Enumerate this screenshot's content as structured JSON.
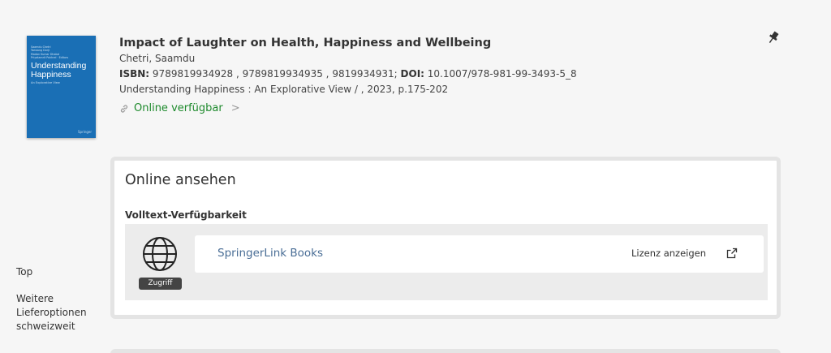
{
  "cover": {
    "authors_small": [
      "Saamdu Chetri",
      "Tsewang Dorji",
      "Madan Kumar Dhakal",
      "Priyatamrit Pokhrel",
      "Editors"
    ],
    "title": "Understanding Happiness",
    "subtitle": "An Explorative View",
    "publisher": "Springer"
  },
  "record": {
    "title": "Impact of Laughter on Health, Happiness and Wellbeing",
    "author": "Chetri, Saamdu",
    "isbn_label": "ISBN:",
    "isbn_values": " 9789819934928 , 9789819934935 , 9819934931; ",
    "doi_label": "DOI:",
    "doi_value": " 10.1007/978-981-99-3493-5_8",
    "source": "Understanding Happiness : An Explorative View / , 2023, p.175-202",
    "availability": "Online verfügbar",
    "availability_chevron": ">"
  },
  "icons": {
    "pin": "pin-icon",
    "link": "link-icon",
    "globe": "globe-icon",
    "external": "external-link-icon"
  },
  "left_nav": {
    "top": "Top",
    "more_options": "Weitere Lieferoptionen schweizweit"
  },
  "online_panel": {
    "heading": "Online ansehen",
    "subheading": "Volltext-Verfügbarkeit",
    "access_badge": "Zugriff",
    "provider_name": "SpringerLink Books",
    "license_link": "Lizenz anzeigen"
  },
  "colors": {
    "available_green": "#1d8a2c",
    "provider_link": "#4a6e96",
    "cover_blue": "#1a6fb5"
  }
}
